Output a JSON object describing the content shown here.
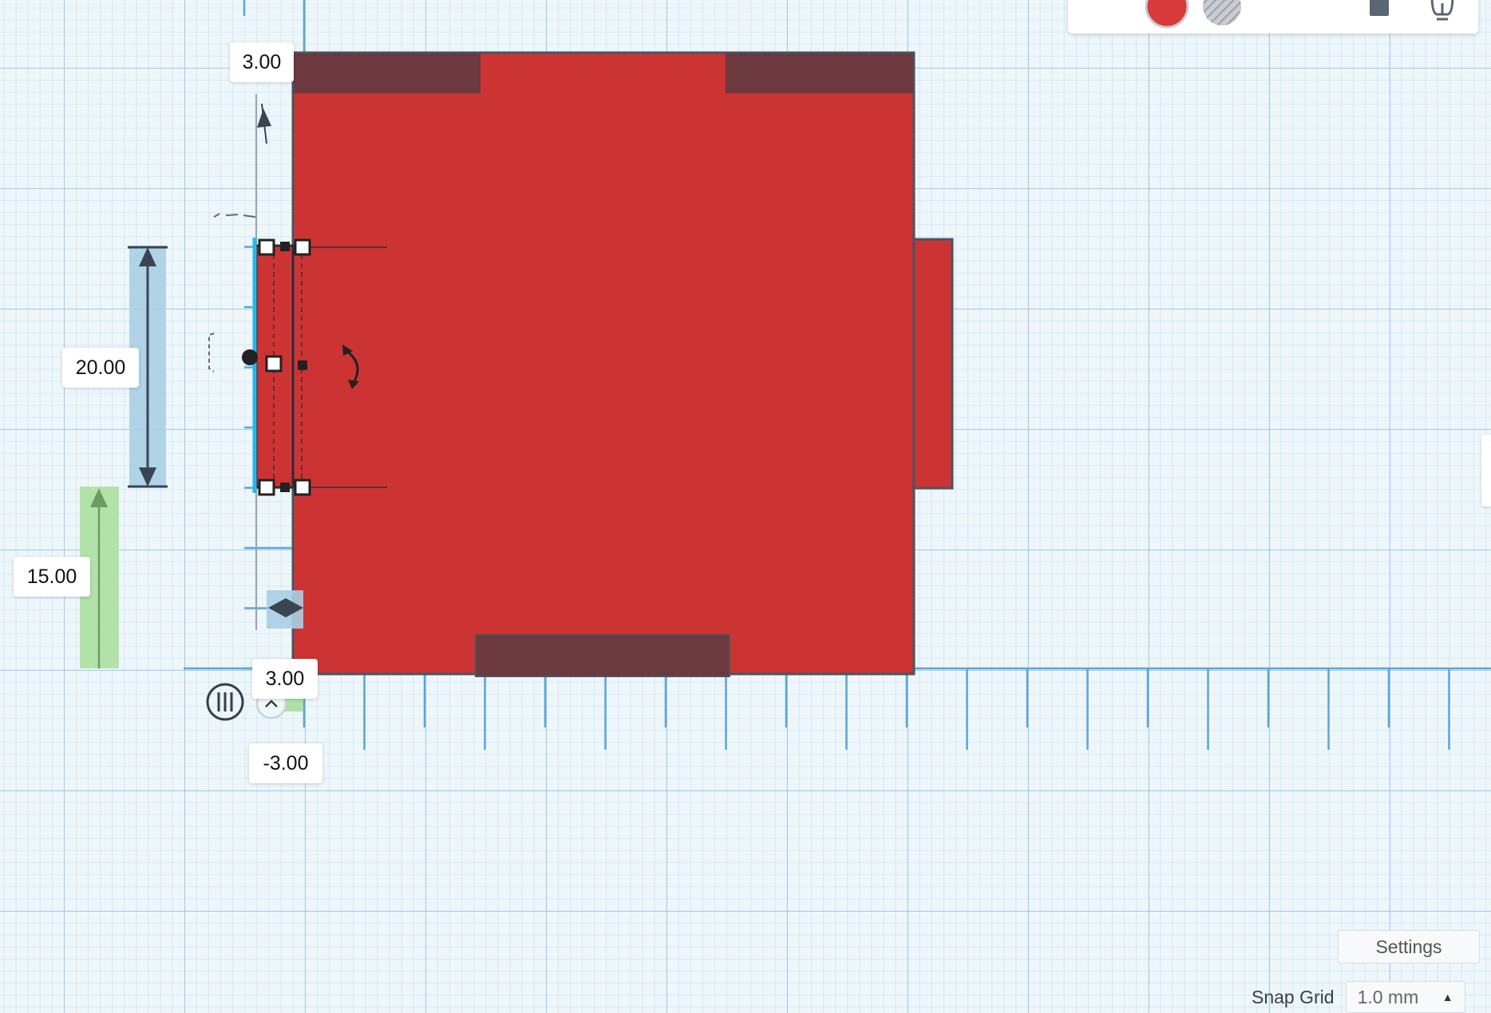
{
  "dimensions": {
    "top_offset": "3.00",
    "height": "20.00",
    "y_offset": "15.00",
    "width": "3.00",
    "x_offset": "-3.00"
  },
  "colors": {
    "solid_red": "#cc3434",
    "hole_dark": "#6b393e",
    "height_bar": "#a9cfe4",
    "yoffset_bar": "#aee0a4",
    "grid_accent": "#5aa6d6"
  },
  "toolbar": {
    "solid_swatch_color": "#d93a3a",
    "icons": [
      "solid-color-swatch",
      "hole-swatch",
      "view-cube-icon",
      "lightbulb-icon"
    ]
  },
  "settings": {
    "label": "Settings"
  },
  "snap_grid": {
    "label": "Snap Grid",
    "value": "1.0 mm"
  }
}
